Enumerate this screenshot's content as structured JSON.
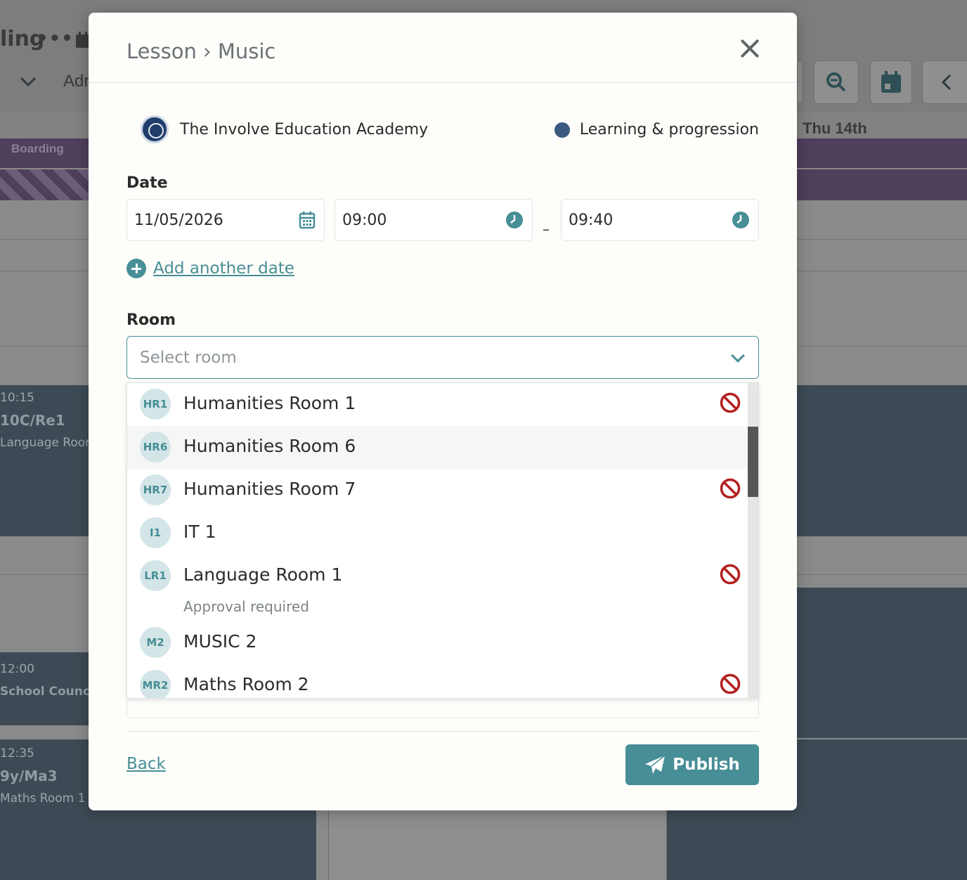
{
  "background": {
    "title": "ling",
    "toolbar_text": "Adr",
    "day_header": "Thu 14th",
    "band_label": "Boarding",
    "events": [
      {
        "time": "10:15",
        "name": "10C/Re1",
        "room": "Language Room"
      },
      {
        "time": "12:00",
        "name": "School Council"
      },
      {
        "time": "12:35",
        "name": "9y/Ma3",
        "room": "Maths Room 1"
      }
    ]
  },
  "modal": {
    "title": "Lesson › Music",
    "school_name": "The Involve Education Academy",
    "category": {
      "label": "Learning & progression",
      "color": "#3a5a7f"
    },
    "date_label": "Date",
    "date_value": "11/05/2026",
    "start_time": "09:00",
    "time_separator": "–",
    "end_time": "09:40",
    "add_date_label": "Add another date",
    "room_label": "Room",
    "room_placeholder": "Select room",
    "rooms": [
      {
        "code": "HR1",
        "name": "Humanities Room 1",
        "unavailable": true
      },
      {
        "code": "HR6",
        "name": "Humanities Room 6",
        "unavailable": false
      },
      {
        "code": "HR7",
        "name": "Humanities Room 7",
        "unavailable": true
      },
      {
        "code": "I1",
        "name": "IT 1",
        "unavailable": false
      },
      {
        "code": "LR1",
        "name": "Language Room 1",
        "note": "Approval required",
        "unavailable": true
      },
      {
        "code": "M2",
        "name": "MUSIC 2",
        "unavailable": false
      },
      {
        "code": "MR2",
        "name": "Maths Room 2",
        "unavailable": true
      }
    ],
    "back_label": "Back",
    "publish_label": "Publish"
  },
  "colors": {
    "accent": "#478e96",
    "unavailable": "#b3201f",
    "overlay": "#8a8a8a"
  }
}
